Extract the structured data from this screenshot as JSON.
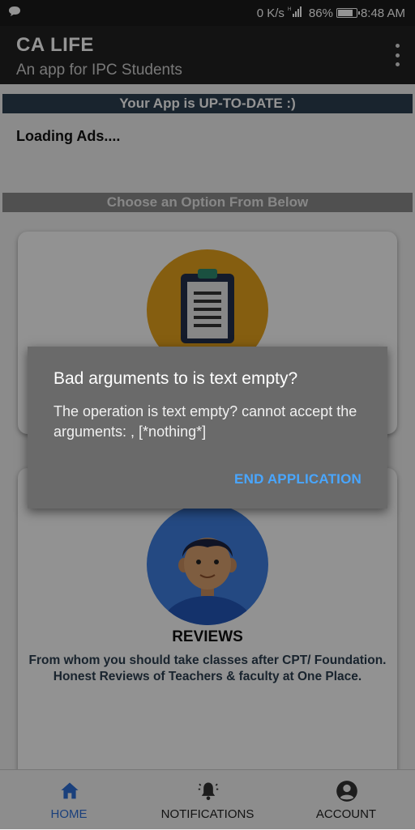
{
  "status_bar": {
    "speed": "0 K/s",
    "battery": "86%",
    "time": "8:48 AM",
    "battery_level": 0.86
  },
  "app_bar": {
    "title": "CA LIFE",
    "subtitle": "An app for IPC Students"
  },
  "main": {
    "update_banner": "Your App is UP-TO-DATE :)",
    "loading_ads": "Loading Ads....",
    "choose_banner": "Choose an Option From Below",
    "reviews_card": {
      "title": "REVIEWS",
      "description": "From whom you should take classes after CPT/ Foundation. Honest Reviews of Teachers & faculty at One Place."
    }
  },
  "bottom_nav": {
    "home": "HOME",
    "notifications": "NOTIFICATIONS",
    "account": "ACCOUNT"
  },
  "dialog": {
    "title": "Bad arguments to is text empty?",
    "message": "The operation is text empty? cannot accept the arguments: , [*nothing*]",
    "button": "END APPLICATION"
  },
  "colors": {
    "accent": "#49a6ff",
    "nav_active": "#2e6fd6",
    "banner": "#2c3e50"
  }
}
